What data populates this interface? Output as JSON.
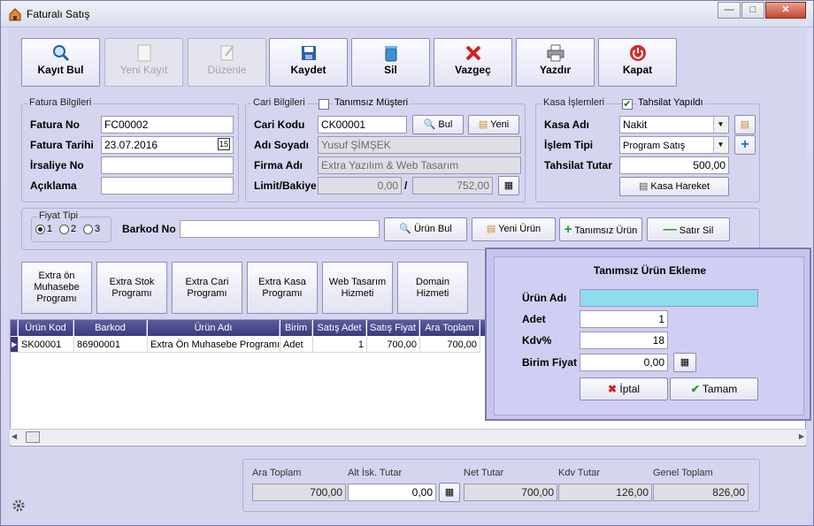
{
  "window": {
    "title": "Faturalı Satış",
    "min": "—",
    "max": "□",
    "close": "✕"
  },
  "toolbar": {
    "kayit_bul": "Kayıt Bul",
    "yeni_kayit": "Yeni Kayıt",
    "duzenle": "Düzenle",
    "kaydet": "Kaydet",
    "sil": "Sil",
    "vazgec": "Vazgeç",
    "yazdir": "Yazdır",
    "kapat": "Kapat"
  },
  "fatura": {
    "title": "Fatura Bilgileri",
    "no_label": "Fatura No",
    "no": "FC00002",
    "tarih_label": "Fatura Tarihi",
    "tarih": "23.07.2016",
    "irsaliye_label": "İrsaliye No",
    "irsaliye": "",
    "aciklama_label": "Açıklama",
    "aciklama": ""
  },
  "cari": {
    "title": "Cari Bilgileri",
    "tanimsiz": "Tanımsız Müşteri",
    "kod_label": "Cari Kodu",
    "kod": "CK00001",
    "bul": "Bul",
    "yeni": "Yeni",
    "ad_label": "Adı Soyadı",
    "ad": "Yusuf ŞİMŞEK",
    "firma_label": "Firma Adı",
    "firma": "Extra Yazılım & Web Tasarım",
    "limit_label": "Limit/Bakiye",
    "limit": "0,00",
    "slash": "/",
    "bakiye": "752,00"
  },
  "kasa": {
    "title": "Kasa İşlemleri",
    "tahsilat": "Tahsilat Yapıldı",
    "tahsilat_checked": true,
    "kasa_label": "Kasa Adı",
    "kasa": "Nakit",
    "islem_label": "İşlem Tipi",
    "islem": "Program Satış",
    "tutar_label": "Tahsilat Tutar",
    "tutar": "500,00",
    "hareket": "Kasa Hareket"
  },
  "urun": {
    "fiyat_title": "Fiyat Tipi",
    "radio1": "1",
    "radio2": "2",
    "radio3": "3",
    "selected": "1",
    "barkod_label": "Barkod No",
    "barkod": "",
    "bul": "Ürün Bul",
    "yeni": "Yeni Ürün",
    "tanimsiz": "Tanımsız Ürün",
    "satir_sil": "Satır Sil"
  },
  "categories": [
    "Extra ön Muhasebe Programı",
    "Extra Stok Programı",
    "Extra Cari Programı",
    "Extra Kasa Programı",
    "Web Tasarım Hizmeti",
    "Domain Hizmeti"
  ],
  "grid": {
    "headers": [
      "Ürün Kod",
      "Barkod",
      "Ürün Adı",
      "Birim",
      "Satış Adet",
      "Satış Fiyat",
      "Ara Toplam"
    ],
    "rows": [
      [
        "SK00001",
        "86900001",
        "Extra Ön Muhasebe Programı",
        "Adet",
        "1",
        "700,00",
        "700,00"
      ]
    ]
  },
  "popup": {
    "title": "Tanımsız Ürün Ekleme",
    "ad_label": "Ürün Adı",
    "ad": "",
    "adet_label": "Adet",
    "adet": "1",
    "kdv_label": "Kdv%",
    "kdv": "18",
    "fiyat_label": "Birim Fiyat",
    "fiyat": "0,00",
    "iptal": "İptal",
    "tamam": "Tamam"
  },
  "totals": {
    "ara_label": "Ara Toplam",
    "ara": "700,00",
    "isk_label": "Alt İsk. Tutar",
    "isk": "0,00",
    "net_label": "Net Tutar",
    "net": "700,00",
    "kdv_label": "Kdv Tutar",
    "kdv": "126,00",
    "genel_label": "Genel Toplam",
    "genel": "826,00"
  },
  "colors": {
    "accent": "#3a3a7c",
    "background": "#d5d5f0",
    "popup_input": "#8ddcf0"
  }
}
